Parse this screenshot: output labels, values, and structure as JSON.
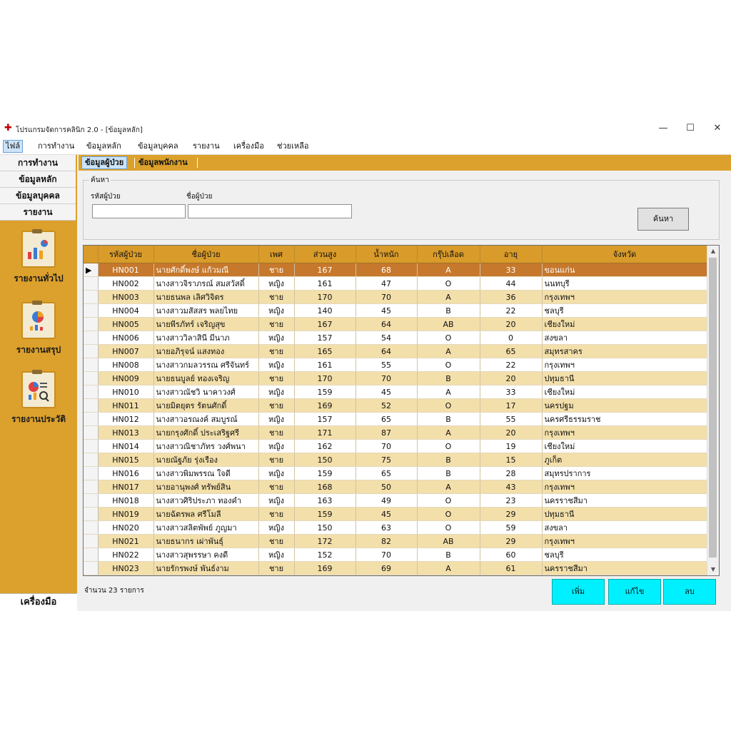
{
  "window": {
    "title": "โปรแกรมจัดการคลินิก 2.0 - [ข้อมูลหลัก]",
    "controls": {
      "minimize": "—",
      "maximize": "☐",
      "close": "✕"
    }
  },
  "menubar": [
    "ไฟล์",
    "การทำงาน",
    "ข้อมูลหลัก",
    "ข้อมูลบุคคล",
    "รายงาน",
    "เครื่องมือ",
    "ช่วยเหลือ"
  ],
  "sidebar": {
    "buttons": [
      "การทำงาน",
      "ข้อมูลหลัก",
      "ข้อมูลบุคคล",
      "รายงาน"
    ],
    "reports": [
      {
        "label": "รายงานทั่วไป",
        "icon": "report-general-icon"
      },
      {
        "label": "รายงานสรุป",
        "icon": "report-summary-icon"
      },
      {
        "label": "รายงานประวัติ",
        "icon": "report-history-icon"
      }
    ],
    "tools": "เครื่องมือ"
  },
  "tabs": [
    "ข้อมูลผู้ป่วย",
    "ข้อมูลพนักงาน"
  ],
  "search": {
    "legend": "ค้นหา",
    "id_label": "รหัสผู้ป่วย",
    "id_value": "",
    "name_label": "ชื่อผู้ป่วย",
    "name_value": "",
    "button": "ค้นหา"
  },
  "table": {
    "columns": [
      "รหัสผู้ป่วย",
      "ชื่อผู้ป่วย",
      "เพศ",
      "ส่วนสูง",
      "น้ำหนัก",
      "กรุ๊ปเลือด",
      "อายุ",
      "จังหวัด"
    ],
    "selected_index": 0,
    "rows": [
      [
        "HN001",
        "นายศักดิ์พงษ์ แก้วมณี",
        "ชาย",
        "167",
        "68",
        "A",
        "33",
        "ขอนแก่น"
      ],
      [
        "HN002",
        "นางสาวจิราภรณ์ สมสวัสดิ์",
        "หญิง",
        "161",
        "47",
        "O",
        "44",
        "นนทบุรี"
      ],
      [
        "HN003",
        "นายธนพล เลิศวิจิตร",
        "ชาย",
        "170",
        "70",
        "A",
        "36",
        "กรุงเทพฯ"
      ],
      [
        "HN004",
        "นางสาวมสัสสร พลยไทย",
        "หญิง",
        "140",
        "45",
        "B",
        "22",
        "ชลบุรี"
      ],
      [
        "HN005",
        "นายพีรภัทร์ เจริญสุข",
        "ชาย",
        "167",
        "64",
        "AB",
        "20",
        "เชียงใหม่"
      ],
      [
        "HN006",
        "นางสาววิลาสินี มีนาภ",
        "หญิง",
        "157",
        "54",
        "O",
        "0",
        "สงขลา"
      ],
      [
        "HN007",
        "นายอภิรุจน์ แสงทอง",
        "ชาย",
        "165",
        "64",
        "A",
        "65",
        "สมุทรสาคร"
      ],
      [
        "HN008",
        "นางสาวกมลวรรณ ศรีจันทร์",
        "หญิง",
        "161",
        "55",
        "O",
        "22",
        "กรุงเทพฯ"
      ],
      [
        "HN009",
        "นายธนบูลย์ ทองเจริญ",
        "ชาย",
        "170",
        "70",
        "B",
        "20",
        "ปทุมธานี"
      ],
      [
        "HN010",
        "นางสาวณัชวิ นาคาวงศ์",
        "หญิง",
        "159",
        "45",
        "A",
        "33",
        "เชียงใหม่"
      ],
      [
        "HN011",
        "นายมิตยุตร รัตนศักดิ์",
        "ชาย",
        "169",
        "52",
        "O",
        "17",
        "นครปฐม"
      ],
      [
        "HN012",
        "นางสาวอรณงค์ สมบูรณ์",
        "หญิง",
        "157",
        "65",
        "B",
        "55",
        "นครศรีธรรมราช"
      ],
      [
        "HN013",
        "นายกรุงศักดิ์ ประเสริฐศรี",
        "ชาย",
        "171",
        "87",
        "A",
        "20",
        "กรุงเทพฯ"
      ],
      [
        "HN014",
        "นางสาวณิชาภัทร วงศ์พนา",
        "หญิง",
        "162",
        "70",
        "O",
        "19",
        "เชียงใหม่"
      ],
      [
        "HN015",
        "นายณัฐภัย รุ่งเรือง",
        "ชาย",
        "150",
        "75",
        "B",
        "15",
        "ภูเก็ต"
      ],
      [
        "HN016",
        "นางสาวพิมพรรณ ใจดี",
        "หญิง",
        "159",
        "65",
        "B",
        "28",
        "สมุทรปราการ"
      ],
      [
        "HN017",
        "นายอานุพงศ์ ทรัพย์สิน",
        "ชาย",
        "168",
        "50",
        "A",
        "43",
        "กรุงเทพฯ"
      ],
      [
        "HN018",
        "นางสาวศิริประภา ทองคำ",
        "หญิง",
        "163",
        "49",
        "O",
        "23",
        "นครราชสีมา"
      ],
      [
        "HN019",
        "นายฉัตรพล ศรีโมลี",
        "ชาย",
        "159",
        "45",
        "O",
        "29",
        "ปทุมธานี"
      ],
      [
        "HN020",
        "นางสาวสลิตพัพย์ ภูญมา",
        "หญิง",
        "150",
        "63",
        "O",
        "59",
        "สงขลา"
      ],
      [
        "HN021",
        "นายธนากร เผ่าพันธุ์",
        "ชาย",
        "172",
        "82",
        "AB",
        "29",
        "กรุงเทพฯ"
      ],
      [
        "HN022",
        "นางสาวสุพรรษา คงดี",
        "หญิง",
        "152",
        "70",
        "B",
        "60",
        "ชลบุรี"
      ],
      [
        "HN023",
        "นายรักรพงษ์ พันธ์งาม",
        "ชาย",
        "169",
        "69",
        "A",
        "61",
        "นครราชสีมา"
      ]
    ]
  },
  "footer": {
    "count_text": "จำนวน 23 รายการ",
    "buttons": [
      "เพิ่ม",
      "แก้ไข",
      "ลบ"
    ]
  }
}
